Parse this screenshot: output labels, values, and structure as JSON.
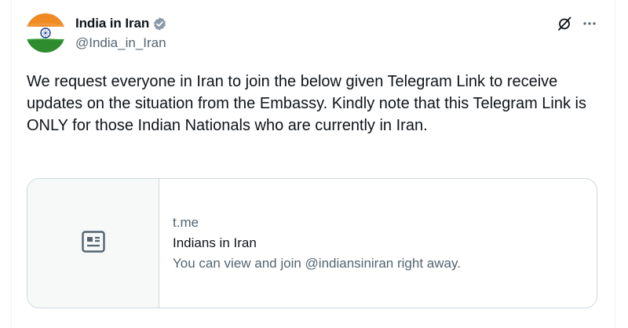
{
  "post": {
    "author": {
      "display_name": "India in Iran",
      "handle": "@India_in_Iran",
      "verified_icon": "verified-badge-icon",
      "verified_color": "#8b98a5"
    },
    "text": "We request everyone in Iran to join the below given Telegram Link to receive updates on the situation from the Embassy. Kindly note that this Telegram Link is ONLY for those Indian Nationals who are currently in Iran.",
    "actions": {
      "grok_icon": "grok-icon",
      "more_icon": "more-horizontal-icon"
    },
    "link_card": {
      "thumbnail_icon": "article-icon",
      "domain": "t.me",
      "title": "Indians in Iran",
      "description": "You can view and join @indiansiniran right away."
    }
  },
  "colors": {
    "text_primary": "#0f1419",
    "text_secondary": "#536471",
    "border": "#cfd9de",
    "card_thumb_bg": "#f7f9f9",
    "flag_saffron": "#f08a24",
    "flag_green": "#2e8b2e",
    "chakra_blue": "#1c3f94"
  }
}
